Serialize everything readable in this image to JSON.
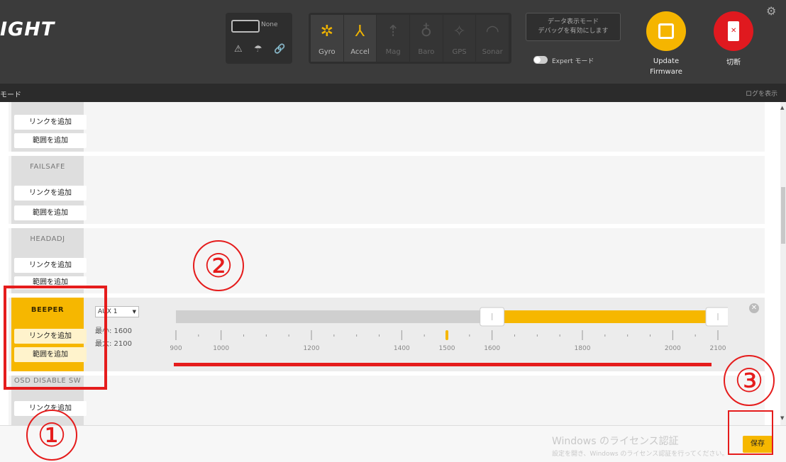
{
  "header": {
    "logo": "IGHT",
    "port_label": "None",
    "sensors": [
      {
        "label": "Gyro",
        "icon": "gyro-icon",
        "active": true
      },
      {
        "label": "Accel",
        "icon": "accel-icon",
        "active": true
      },
      {
        "label": "Mag",
        "icon": "mag-icon",
        "active": false
      },
      {
        "label": "Baro",
        "icon": "baro-icon",
        "active": false
      },
      {
        "label": "GPS",
        "icon": "gps-icon",
        "active": false
      },
      {
        "label": "Sonar",
        "icon": "sonar-icon",
        "active": false
      }
    ],
    "enter_cli_line1": "データ表示モード",
    "enter_cli_line2": "デバッグを有効にします",
    "expert_label": "Expert モード",
    "update_label_1": "Update",
    "update_label_2": "Firmware",
    "disconnect_label": "切断"
  },
  "subbar": {
    "title": "モード",
    "log": "ログを表示"
  },
  "modes": [
    {
      "name": "",
      "add_link": "リンクを追加",
      "add_range": "範囲を追加"
    },
    {
      "name": "FAILSAFE",
      "add_link": "リンクを追加",
      "add_range": "範囲を追加"
    },
    {
      "name": "HEADADJ",
      "add_link": "リンクを追加",
      "add_range": "範囲を追加"
    },
    {
      "name": "BEEPER",
      "add_link": "リンクを追加",
      "add_range": "範囲を追加"
    },
    {
      "name": "OSD DISABLE SW",
      "add_link": "リンクを追加",
      "add_range": ""
    }
  ],
  "beeper": {
    "channel": "AUX 1",
    "min_label": "最小: 1600",
    "max_label": "最大: 2100",
    "range_min": 1600,
    "range_max": 2100,
    "current_value": 1500,
    "scale_min": 900,
    "scale_max": 2100,
    "tick_labels": [
      "900",
      "1000",
      "1200",
      "1400",
      "1500",
      "1600",
      "1800",
      "2000",
      "2100"
    ],
    "tick_values": [
      900,
      1000,
      1200,
      1400,
      1500,
      1600,
      1800,
      2000,
      2100
    ],
    "fill_color": "#f6b700"
  },
  "footer": {
    "watermark_line1": "Windows のライセンス認証",
    "watermark_line2": "設定を開き、Windows のライセンス認証を行ってください。",
    "save_label": "保存"
  },
  "annotations": [
    "①",
    "②",
    "③"
  ],
  "colors": {
    "accent": "#f6b700",
    "update": "#f5b500",
    "disconnect": "#e0191f",
    "annotation": "#e51c1c"
  }
}
